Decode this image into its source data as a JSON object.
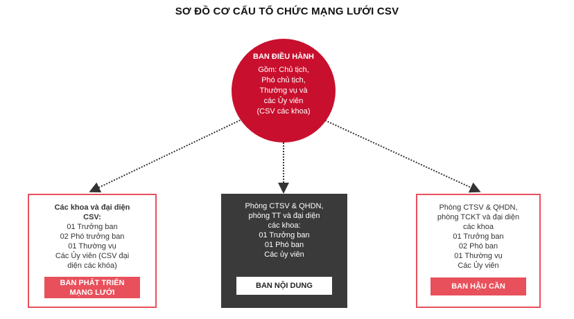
{
  "title": "SƠ ĐỒ CƠ CẤU TỔ CHỨC MẠNG LƯỚI CSV",
  "exec_board": {
    "title": "BAN ĐIỀU HÀNH",
    "lines": [
      "Gồm: Chủ tịch,",
      "Phó chủ tịch,",
      "Thường vụ và",
      "các Ủy viên",
      "(CSV các khoa)"
    ]
  },
  "left_box": {
    "heading": [
      "Các khoa và đại diện",
      "CSV:"
    ],
    "lines": [
      "01 Trưởng ban",
      "02 Phó trưởng ban",
      "01 Thường vụ",
      "Các Ủy viên (CSV đại",
      "diện các khóa)"
    ],
    "label": [
      "BAN PHÁT TRIỂN",
      "MẠNG LƯỚI"
    ]
  },
  "mid_box": {
    "lines": [
      "Phòng CTSV & QHDN,",
      "phòng TT và đại diện",
      "các khoa:",
      "01 Trưởng ban",
      "01 Phó ban",
      "Các ủy viên"
    ],
    "label": "BAN NỘI DUNG"
  },
  "right_box": {
    "lines": [
      "Phòng CTSV & QHDN,",
      "phòng TCKT và đại diện",
      "các khoa",
      "01 Trưởng ban",
      "02 Phó ban",
      "01 Thường vụ",
      "Các Ủy viên"
    ],
    "label": "BAN HẬU CẦN"
  },
  "colors": {
    "primary_red": "#c8102e",
    "accent_red": "#e8505b",
    "dark_box": "#3a3a3a"
  }
}
